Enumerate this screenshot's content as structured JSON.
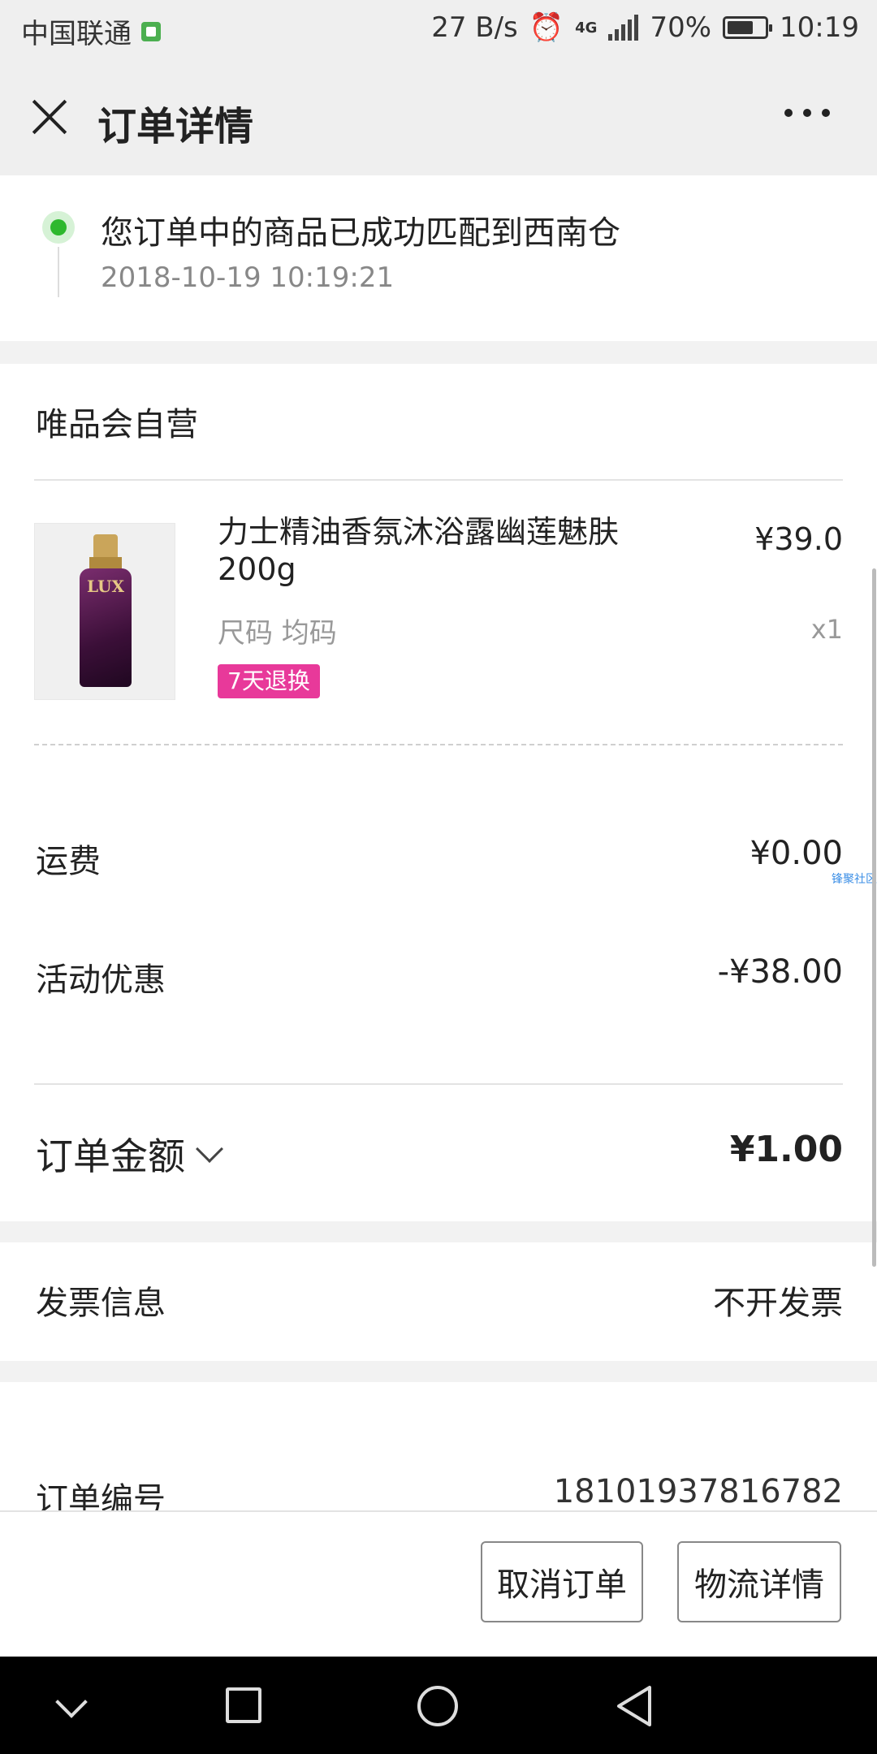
{
  "status_bar": {
    "carrier": "中国联通",
    "net_speed": "27 B/s",
    "network": "4G",
    "battery": "70%",
    "battery_level": 0.7,
    "time": "10:19"
  },
  "header": {
    "title": "订单详情"
  },
  "order_status": {
    "message": "您订单中的商品已成功匹配到西南仓",
    "timestamp": "2018-10-19 10:19:21"
  },
  "store": {
    "name": "唯品会自营"
  },
  "product": {
    "image_logo": "LUX",
    "name": "力士精油香氛沐浴露幽莲魅肤200g",
    "price": "¥39.0",
    "spec": "尺码 均码",
    "quantity": "x1",
    "badge": "7天退换"
  },
  "summary": {
    "shipping_label": "运费",
    "shipping_value": "¥0.00",
    "discount_label": "活动优惠",
    "discount_value": "-¥38.00",
    "total_label": "订单金额",
    "total_value": "¥1.00"
  },
  "invoice": {
    "label": "发票信息",
    "value": "不开发票"
  },
  "order_info": {
    "number_label": "订单编号",
    "number_value": "18101937816782"
  },
  "watermark": "锋聚社区",
  "actions": {
    "cancel_label": "取消订单",
    "logistics_label": "物流详情"
  },
  "colors": {
    "accent_green": "#2eb82e",
    "badge_pink": "#e8399a"
  }
}
